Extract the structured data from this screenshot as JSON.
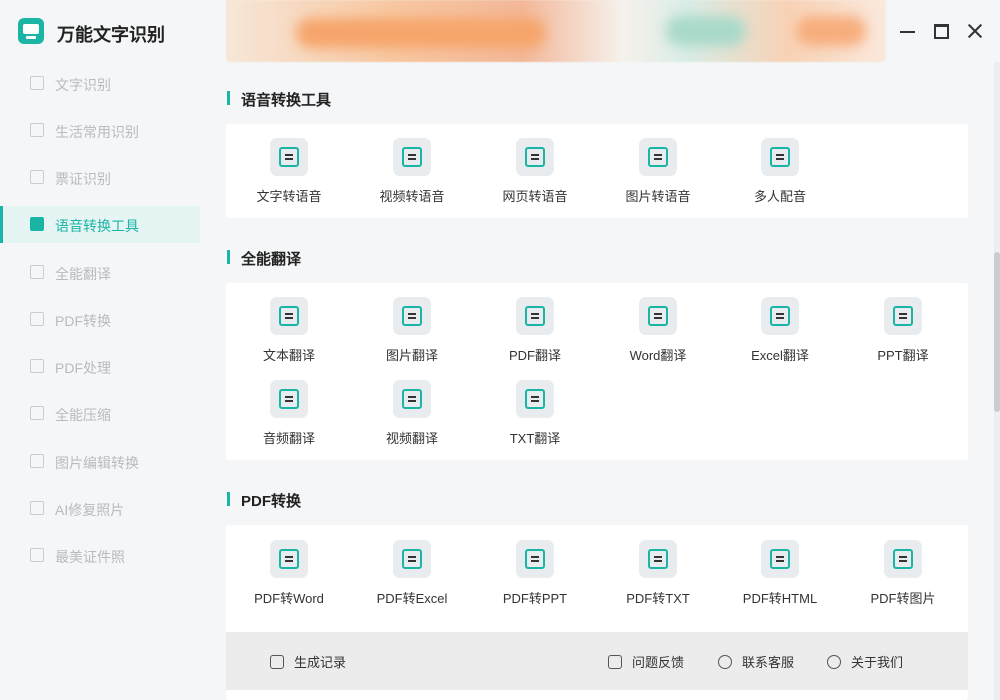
{
  "app": {
    "title": "万能文字识别"
  },
  "sidebar": {
    "items": [
      {
        "label": "文字识别",
        "icon": "text-scan-icon"
      },
      {
        "label": "生活常用识别",
        "icon": "life-scan-icon"
      },
      {
        "label": "票证识别",
        "icon": "ticket-scan-icon"
      },
      {
        "label": "语音转换工具",
        "icon": "voice-convert-icon",
        "active": true
      },
      {
        "label": "全能翻译",
        "icon": "translate-icon"
      },
      {
        "label": "PDF转换",
        "icon": "pdf-convert-icon"
      },
      {
        "label": "PDF处理",
        "icon": "pdf-process-icon"
      },
      {
        "label": "全能压缩",
        "icon": "compress-icon"
      },
      {
        "label": "图片编辑转换",
        "icon": "image-edit-icon"
      },
      {
        "label": "AI修复照片",
        "icon": "ai-repair-icon"
      },
      {
        "label": "最美证件照",
        "icon": "id-photo-icon"
      }
    ]
  },
  "sections": [
    {
      "title": "语音转换工具",
      "tools": [
        {
          "label": "文字转语音",
          "icon": "text-to-speech-icon"
        },
        {
          "label": "视频转语音",
          "icon": "video-to-speech-icon"
        },
        {
          "label": "网页转语音",
          "icon": "web-to-speech-icon"
        },
        {
          "label": "图片转语音",
          "icon": "image-to-speech-icon"
        },
        {
          "label": "多人配音",
          "icon": "multi-voice-icon"
        }
      ]
    },
    {
      "title": "全能翻译",
      "tools": [
        {
          "label": "文本翻译",
          "icon": "text-translate-icon"
        },
        {
          "label": "图片翻译",
          "icon": "image-translate-icon"
        },
        {
          "label": "PDF翻译",
          "icon": "pdf-translate-icon"
        },
        {
          "label": "Word翻译",
          "icon": "word-translate-icon"
        },
        {
          "label": "Excel翻译",
          "icon": "excel-translate-icon"
        },
        {
          "label": "PPT翻译",
          "icon": "ppt-translate-icon"
        },
        {
          "label": "音频翻译",
          "icon": "audio-translate-icon"
        },
        {
          "label": "视频翻译",
          "icon": "video-translate-icon"
        },
        {
          "label": "TXT翻译",
          "icon": "txt-translate-icon"
        }
      ]
    },
    {
      "title": "PDF转换",
      "tools": [
        {
          "label": "PDF转Word",
          "icon": "pdf-to-word-icon"
        },
        {
          "label": "PDF转Excel",
          "icon": "pdf-to-excel-icon"
        },
        {
          "label": "PDF转PPT",
          "icon": "pdf-to-ppt-icon"
        },
        {
          "label": "PDF转TXT",
          "icon": "pdf-to-txt-icon"
        },
        {
          "label": "PDF转HTML",
          "icon": "pdf-to-html-icon"
        },
        {
          "label": "PDF转图片",
          "icon": "pdf-to-image-icon"
        }
      ]
    }
  ],
  "footer": {
    "history": "生成记录",
    "feedback": "问题反馈",
    "support": "联系客服",
    "about": "关于我们"
  },
  "colors": {
    "accent": "#1bb5a6"
  }
}
